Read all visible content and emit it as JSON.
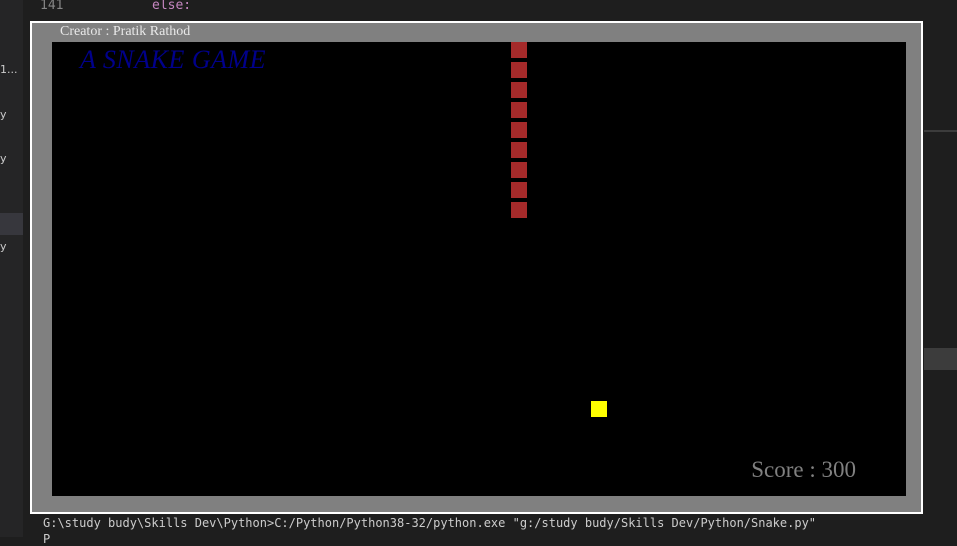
{
  "editor": {
    "line_number": "141",
    "code": "else:",
    "sidebar_items": [
      "1...",
      "y",
      "y",
      "",
      "y"
    ]
  },
  "terminal": {
    "command": "G:\\study budy\\Skills Dev\\Python>C:/Python/Python38-32/python.exe \"g:/study budy/Skills Dev/Python/Snake.py\"",
    "line2": "P"
  },
  "game": {
    "creator": "Creator : Pratik Rathod",
    "title": "A SNAKE GAME",
    "score_label": "Score : 300",
    "colors": {
      "snake": "#a52a2a",
      "food": "#ffff00",
      "title": "#00008b",
      "score": "#808080",
      "canvas_bg": "#000000",
      "frame": "#808080"
    },
    "snake_length": 9
  }
}
